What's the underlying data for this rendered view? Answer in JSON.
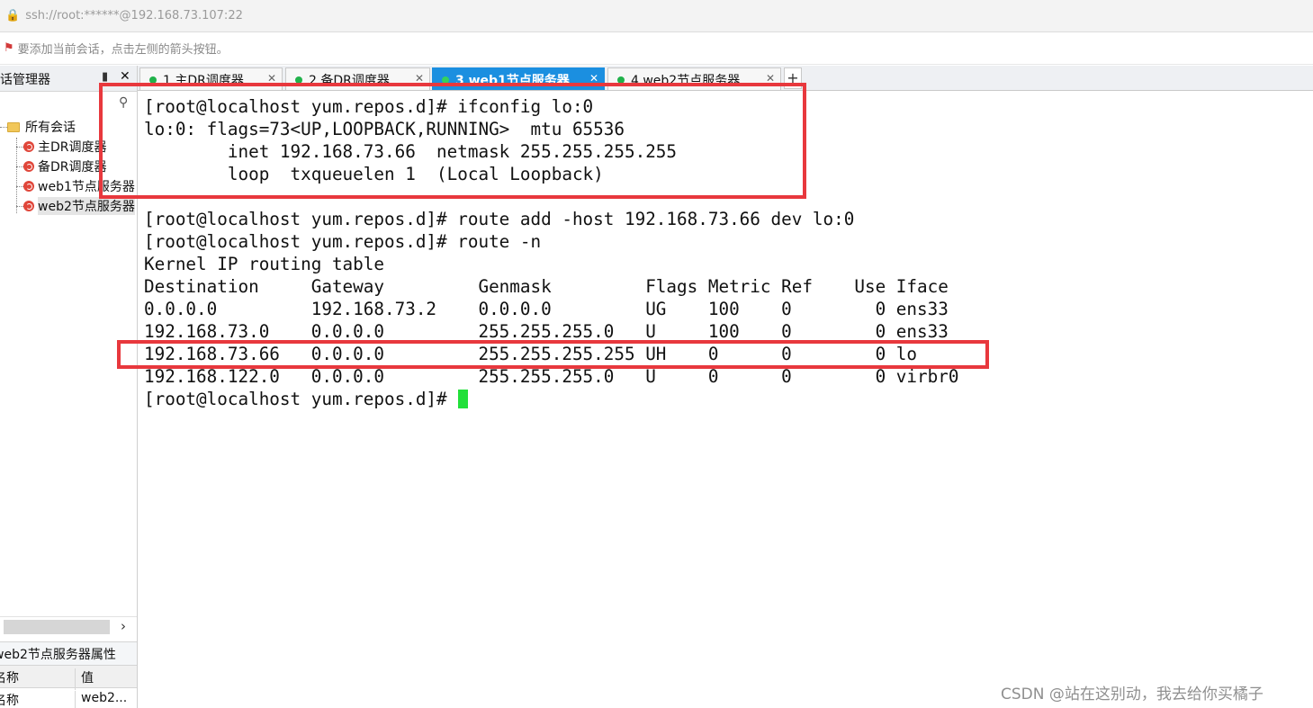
{
  "window": {
    "address": "ssh://root:******@192.168.73.107:22",
    "hint": "要添加当前会话，点击左侧的箭头按钮。"
  },
  "sidebar": {
    "title": "会话管理器",
    "root_label": "所有会话",
    "items": [
      {
        "label": "主DR调度器"
      },
      {
        "label": "备DR调度器"
      },
      {
        "label": "web1节点服务器"
      },
      {
        "label": "web2节点服务器"
      }
    ],
    "properties": {
      "title": "web2节点服务器属性",
      "col_name": "名称",
      "col_value": "值",
      "row_name": "名称",
      "row_value": "web2..."
    }
  },
  "tabs": [
    {
      "label": "1 主DR调度器",
      "active": false
    },
    {
      "label": "2 备DR调度器",
      "active": false
    },
    {
      "label": "3 web1节点服务器",
      "active": true
    },
    {
      "label": "4 web2节点服务器",
      "active": false
    }
  ],
  "terminal": {
    "lines": [
      "[root@localhost yum.repos.d]# ifconfig lo:0",
      "lo:0: flags=73<UP,LOOPBACK,RUNNING>  mtu 65536",
      "        inet 192.168.73.66  netmask 255.255.255.255",
      "        loop  txqueuelen 1  (Local Loopback)",
      "",
      "[root@localhost yum.repos.d]# route add -host 192.168.73.66 dev lo:0",
      "[root@localhost yum.repos.d]# route -n",
      "Kernel IP routing table",
      "Destination     Gateway         Genmask         Flags Metric Ref    Use Iface",
      "0.0.0.0         192.168.73.2    0.0.0.0         UG    100    0        0 ens33",
      "192.168.73.0    0.0.0.0         255.255.255.0   U     100    0        0 ens33",
      "192.168.73.66   0.0.0.0         255.255.255.255 UH    0      0        0 lo",
      "192.168.122.0   0.0.0.0         255.255.255.0   U     0      0        0 virbr0"
    ],
    "prompt": "[root@localhost yum.repos.d]# "
  },
  "watermark": "CSDN @站在这别动，我去给你买橘子",
  "colors": {
    "accent_tab": "#1b8fe0",
    "highlight": "#e8383d",
    "cursor": "#22e03a",
    "status_dot": "#21b24b"
  }
}
